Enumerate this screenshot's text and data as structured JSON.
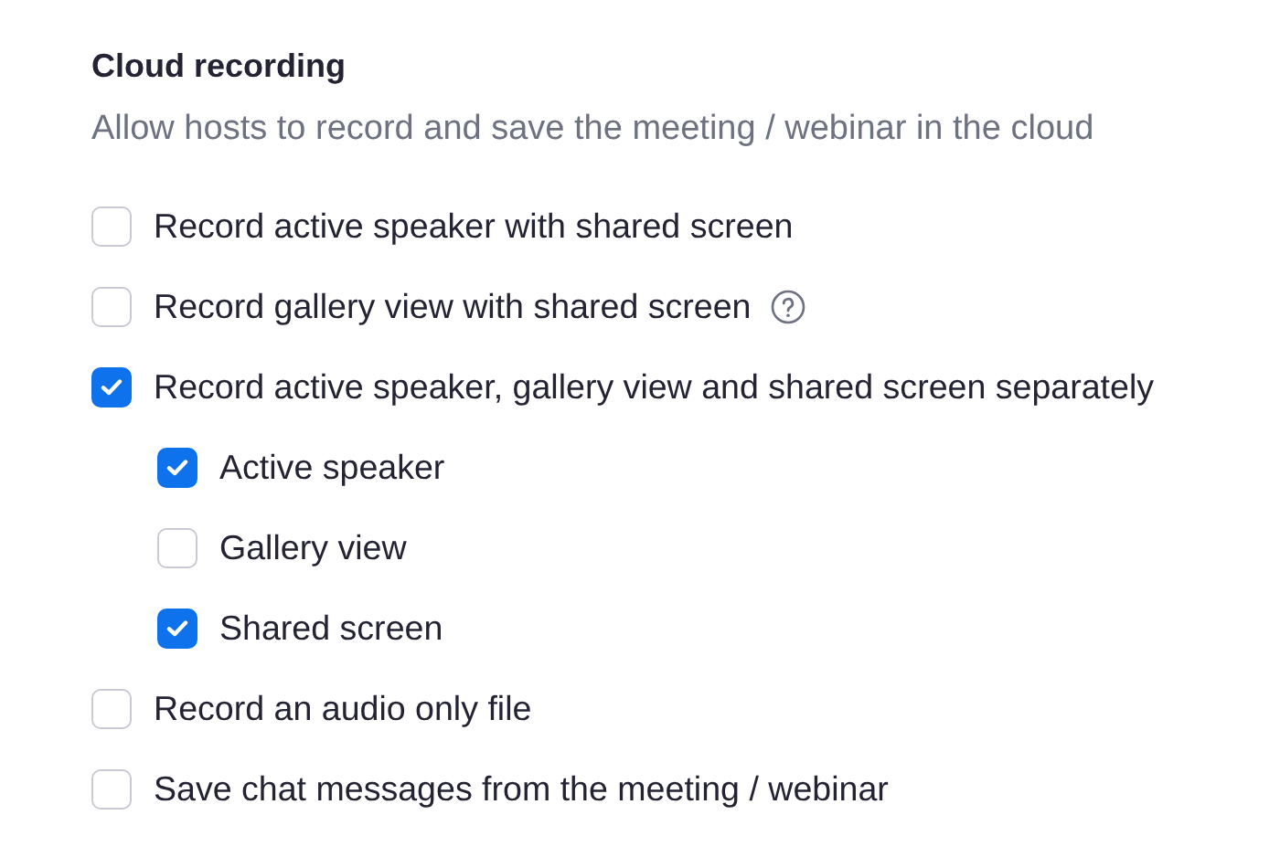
{
  "section": {
    "title": "Cloud recording",
    "description": "Allow hosts to record and save the meeting / webinar in the cloud",
    "options": [
      {
        "label": "Record active speaker with shared screen",
        "checked": false,
        "help": false
      },
      {
        "label": "Record gallery view with shared screen",
        "checked": false,
        "help": true
      },
      {
        "label": "Record active speaker, gallery view and shared screen separately",
        "checked": true,
        "help": false,
        "children": [
          {
            "label": "Active speaker",
            "checked": true,
            "help": false
          },
          {
            "label": "Gallery view",
            "checked": false,
            "help": false
          },
          {
            "label": "Shared screen",
            "checked": true,
            "help": false
          }
        ]
      },
      {
        "label": "Record an audio only file",
        "checked": false,
        "help": false
      },
      {
        "label": "Save chat messages from the meeting / webinar",
        "checked": false,
        "help": false
      }
    ]
  }
}
